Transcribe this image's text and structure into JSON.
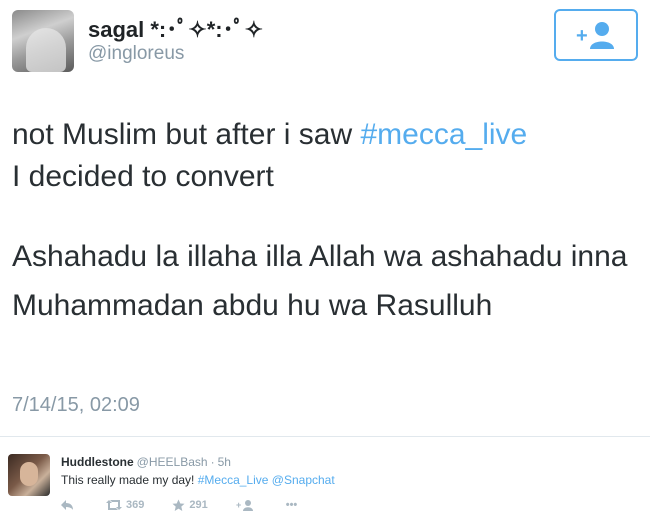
{
  "header": {
    "display_name": "sagal *:･ﾟ✧*:･ﾟ✧",
    "handle": "@ingloreus",
    "follow_icon": "follow-user-plus-icon"
  },
  "tweet": {
    "text_part1": "not Muslim but after i saw ",
    "hashtag": "#mecca_live",
    "text_line2": "I decided to convert",
    "arabic_text": "Ashahadu la illaha illa Allah wa ashahadu inna Muhammadan abdu hu wa Rasulluh",
    "timestamp": "7/14/15, 02:09"
  },
  "embedded_tweet": {
    "name": "Huddlestone",
    "handle": "@HEELBash",
    "separator": "·",
    "time": "5h",
    "text_prefix": "This really made my day! ",
    "hashtag": "#Mecca_Live",
    "mention": "@Snapchat",
    "retweets": "369",
    "favorites": "291",
    "more": "•••"
  },
  "colors": {
    "accent": "#55acee",
    "muted": "#8899a6",
    "text": "#292f33"
  }
}
